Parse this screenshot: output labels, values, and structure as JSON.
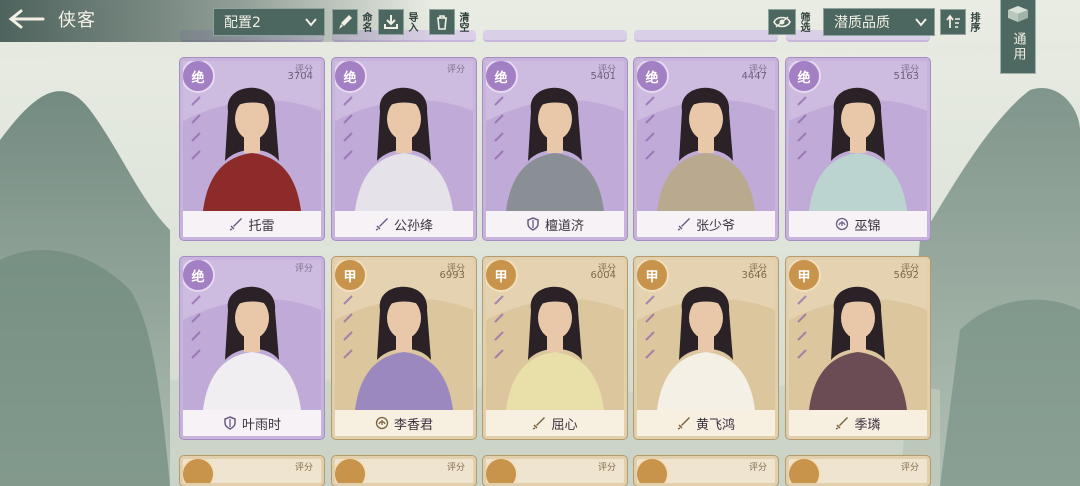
{
  "header": {
    "title": "侠客",
    "preset": "配置2",
    "rename_label": "命名",
    "import_label": "导入",
    "clear_label": "清空",
    "filter_visible_label": "筛选",
    "sort_field": "潜质品质",
    "sort_label": "排序",
    "general_tab_label": "通用"
  },
  "top_partial_row": [
    {
      "grade": "",
      "score_label": "",
      "score": ""
    },
    {
      "grade": "",
      "score_label": "",
      "score": ""
    },
    {
      "grade": "",
      "score_label": "",
      "score": ""
    },
    {
      "grade": "",
      "score_label": "",
      "score": ""
    },
    {
      "grade": "",
      "score_label": "",
      "score": ""
    }
  ],
  "cards": [
    {
      "name": "托雷",
      "grade": "绝",
      "score_label": "评分",
      "score": "3704",
      "tier": "purple",
      "weapon": "sword-icon"
    },
    {
      "name": "公孙绛",
      "grade": "绝",
      "score_label": "评分",
      "score": "",
      "tier": "purple",
      "weapon": "sword-icon"
    },
    {
      "name": "檀道济",
      "grade": "绝",
      "score_label": "评分",
      "score": "5401",
      "tier": "purple",
      "weapon": "shield-icon"
    },
    {
      "name": "张少爷",
      "grade": "绝",
      "score_label": "评分",
      "score": "4447",
      "tier": "purple",
      "weapon": "sword-icon"
    },
    {
      "name": "巫锦",
      "grade": "绝",
      "score_label": "评分",
      "score": "5163",
      "tier": "purple",
      "weapon": "lotus-icon"
    },
    {
      "name": "叶雨时",
      "grade": "绝",
      "score_label": "评分",
      "score": "",
      "tier": "purple",
      "weapon": "shield-icon"
    },
    {
      "name": "李香君",
      "grade": "甲",
      "score_label": "评分",
      "score": "6993",
      "tier": "gold",
      "weapon": "lotus-icon"
    },
    {
      "name": "屈心",
      "grade": "甲",
      "score_label": "评分",
      "score": "6004",
      "tier": "gold",
      "weapon": "sword-icon"
    },
    {
      "name": "黄飞鸿",
      "grade": "甲",
      "score_label": "评分",
      "score": "3646",
      "tier": "gold",
      "weapon": "sword-icon"
    },
    {
      "name": "季璘",
      "grade": "甲",
      "score_label": "评分",
      "score": "5692",
      "tier": "gold",
      "weapon": "sword-icon"
    }
  ],
  "bottom_partial_row": [
    {
      "grade": "",
      "score_label": "评分"
    },
    {
      "grade": "",
      "score_label": "评分"
    },
    {
      "grade": "",
      "score_label": "评分"
    },
    {
      "grade": "",
      "score_label": "评分"
    },
    {
      "grade": "",
      "score_label": "评分"
    }
  ],
  "colors": {
    "purple_tier": "#a37fc4",
    "gold_tier": "#c8934b",
    "toolbar": "#4c6660"
  }
}
